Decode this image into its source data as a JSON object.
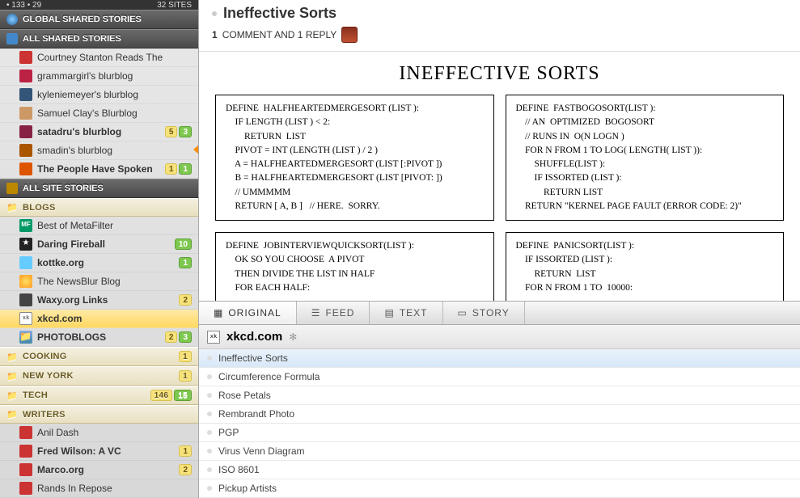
{
  "topbar": {
    "left": "• 133  • 29",
    "right": "32 SITES"
  },
  "sections": {
    "global": "GLOBAL SHARED STORIES",
    "all_shared": "ALL SHARED STORIES",
    "all_site": "ALL SITE STORIES"
  },
  "shared_feeds": [
    {
      "name": "Courtney Stanton Reads The",
      "bold": false,
      "color": "#c33"
    },
    {
      "name": "grammargirl's blurblog",
      "bold": false,
      "color": "#b24"
    },
    {
      "name": "kyleniemeyer's blurblog",
      "bold": false,
      "color": "#357"
    },
    {
      "name": "Samuel Clay's Blurblog",
      "bold": false,
      "color": "#c96"
    },
    {
      "name": "satadru's blurblog",
      "bold": true,
      "color": "#824",
      "badges": [
        [
          "5",
          "yellow"
        ],
        [
          "3",
          "green"
        ]
      ]
    },
    {
      "name": "smadin's blurblog",
      "bold": false,
      "color": "#a50",
      "arrow": true
    },
    {
      "name": "The People Have Spoken",
      "bold": true,
      "color": "#d50",
      "badges": [
        [
          "1",
          "yellow"
        ],
        [
          "1",
          "green"
        ]
      ]
    }
  ],
  "folders": [
    {
      "label": "BLOGS",
      "items": [
        {
          "name": "Best of MetaFilter",
          "cls": "fv-mf"
        },
        {
          "name": "Daring Fireball",
          "cls": "fv-star",
          "bold": true,
          "badges": [
            [
              "10",
              "green"
            ]
          ]
        },
        {
          "name": "kottke.org",
          "cls": "fv-blue",
          "bold": true,
          "badges": [
            [
              "1",
              "green"
            ]
          ]
        },
        {
          "name": "The NewsBlur Blog",
          "cls": "fv-sun"
        },
        {
          "name": "Waxy.org Links",
          "cls": "fv-waxy",
          "bold": true,
          "badges": [
            [
              "2",
              "yellow"
            ]
          ]
        },
        {
          "name": "xkcd.com",
          "cls": "fv-xkcd",
          "bold": true,
          "selected": true
        },
        {
          "name": "PHOTOBLOGS",
          "cls": "fv-photo",
          "bold": true,
          "badges": [
            [
              "2",
              "yellow"
            ],
            [
              "3",
              "green"
            ]
          ],
          "isfolder": true
        }
      ]
    },
    {
      "label": "COOKING",
      "bold": true,
      "badges": [
        [
          "1",
          "yellow"
        ]
      ]
    },
    {
      "label": "NEW YORK",
      "bold": true,
      "badges": [
        [
          "1",
          "yellow"
        ]
      ]
    },
    {
      "label": "TECH",
      "bold": true,
      "badges": [
        [
          "146",
          "yellow"
        ],
        [
          "15",
          "green"
        ]
      ]
    },
    {
      "label": "WRITERS",
      "items": [
        {
          "name": "Anil Dash",
          "cls": "fv-generic"
        },
        {
          "name": "Fred Wilson: A VC",
          "cls": "fv-generic",
          "bold": true,
          "badges": [
            [
              "1",
              "yellow"
            ]
          ]
        },
        {
          "name": "Marco.org",
          "cls": "fv-generic",
          "bold": true,
          "badges": [
            [
              "2",
              "yellow"
            ]
          ]
        },
        {
          "name": "Rands In Repose",
          "cls": "fv-generic"
        }
      ]
    }
  ],
  "story": {
    "title": "Ineffective Sorts",
    "comments": "1",
    "comments_text": "COMMENT AND 1 REPLY"
  },
  "comic": {
    "title": "INEFFECTIVE  SORTS",
    "boxes": [
      "DEFINE  HALFHEARTEDMERGESORT (LIST ):\n    IF LENGTH (LIST ) < 2:\n        RETURN  LIST\n    PIVOT = INT (LENGTH (LIST ) / 2 )\n    A = HALFHEARTEDMERGESORT (LIST [:PIVOT ])\n    B = HALFHEARTEDMERGESORT (LIST [PIVOT: ])\n    // UMMMMM\n    RETURN [ A, B ]   // HERE.  SORRY.",
      "DEFINE  FASTBOGOSORT(LIST ):\n    // AN  OPTIMIZED  BOGOSORT\n    // RUNS IN  O(N LOGN )\n    FOR N FROM 1 TO LOG( LENGTH( LIST )):\n        SHUFFLE(LIST ):\n        IF ISSORTED (LIST ):\n            RETURN LIST\n    RETURN \"KERNEL PAGE FAULT (ERROR CODE: 2)\"",
      "DEFINE  JOBINTERVIEWQUICKSORT(LIST ):\n    OK SO YOU CHOOSE  A PIVOT\n    THEN DIVIDE THE LIST IN HALF\n    FOR EACH HALF:",
      "DEFINE  PANICSORT(LIST ):\n    IF ISSORTED (LIST ):\n        RETURN  LIST\n    FOR N FROM 1 TO  10000:"
    ]
  },
  "view_tabs": [
    "ORIGINAL",
    "FEED",
    "TEXT",
    "STORY"
  ],
  "feed_header": {
    "name": "xkcd.com"
  },
  "story_list": [
    {
      "title": "Ineffective Sorts",
      "selected": true
    },
    {
      "title": "Circumference Formula"
    },
    {
      "title": "Rose Petals"
    },
    {
      "title": "Rembrandt Photo"
    },
    {
      "title": "PGP"
    },
    {
      "title": "Virus Venn Diagram"
    },
    {
      "title": "ISO 8601"
    },
    {
      "title": "Pickup Artists"
    }
  ]
}
